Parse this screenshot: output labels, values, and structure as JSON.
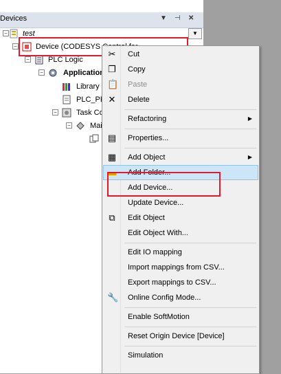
{
  "panel": {
    "title": "Devices",
    "pin_glyph": "⊣",
    "dropdown_glyph": "▼",
    "pin_icon": "pin-icon",
    "close_glyph": "✕",
    "tree": [
      {
        "label": "test",
        "icon": "project-icon",
        "style": "italic"
      },
      {
        "label": "Device (CODESYS Control for ...",
        "icon": "device-icon"
      },
      {
        "label": "PLC Logic",
        "icon": "plc-logic-icon"
      },
      {
        "label": "Application",
        "icon": "gear-icon",
        "style": "bold"
      },
      {
        "label": "Library",
        "icon": "library-icon"
      },
      {
        "label": "PLC_PR",
        "icon": "document-icon"
      },
      {
        "label": "Task Co",
        "icon": "task-config-icon"
      },
      {
        "label": "Mai",
        "icon": "task-icon"
      },
      {
        "label": "",
        "icon": "program-call-icon"
      }
    ]
  },
  "context_menu": {
    "items": [
      {
        "label": "Cut",
        "icon": "scissors-icon",
        "glyph": "✂",
        "disabled": false
      },
      {
        "label": "Copy",
        "icon": "copy-icon",
        "glyph": "❐",
        "disabled": false
      },
      {
        "label": "Paste",
        "icon": "paste-icon",
        "glyph": "📋",
        "disabled": true
      },
      {
        "label": "Delete",
        "icon": "delete-icon",
        "glyph": "✕",
        "disabled": false
      },
      {
        "label": "Refactoring",
        "submenu": true
      },
      {
        "label": "Properties...",
        "icon": "properties-icon",
        "glyph": "▤"
      },
      {
        "label": "Add Object",
        "icon": "add-object-icon",
        "glyph": "▦",
        "submenu": true
      },
      {
        "label": "Add Folder...",
        "icon": "folder-icon",
        "glyph": "▬",
        "highlighted": true
      },
      {
        "label": "Add Device..."
      },
      {
        "label": "Update Device..."
      },
      {
        "label": "Edit Object",
        "icon": "edit-object-icon",
        "glyph": "⧉"
      },
      {
        "label": "Edit Object With..."
      },
      {
        "label": "Edit IO mapping"
      },
      {
        "label": "Import mappings from CSV..."
      },
      {
        "label": "Export mappings to CSV..."
      },
      {
        "label": "Online Config Mode...",
        "icon": "wrench-icon",
        "glyph": "🔧"
      },
      {
        "label": "Enable SoftMotion"
      },
      {
        "label": "Reset Origin Device [Device]"
      },
      {
        "label": "Simulation"
      }
    ],
    "submenu_arrow": "▶"
  },
  "colors": {
    "highlight_bg": "#cde6f7",
    "annotation_red": "#e3172d",
    "menu_bg": "#f0f0f0"
  }
}
